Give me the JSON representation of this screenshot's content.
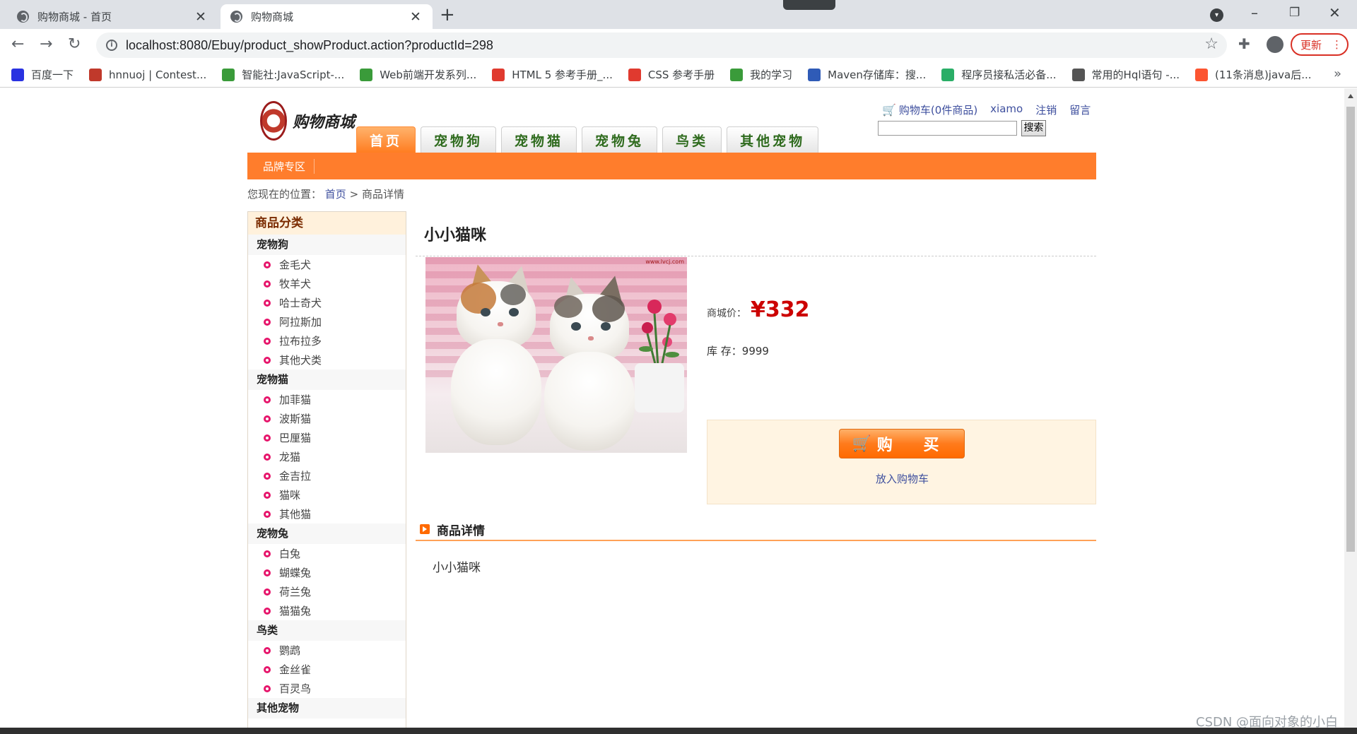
{
  "browser": {
    "tabs": [
      {
        "title": "购物商城 - 首页",
        "active": false
      },
      {
        "title": "购物商城",
        "active": true
      }
    ],
    "new_tab_symbol": "+",
    "url": "localhost:8080/Ebuy/product_showProduct.action?productId=298",
    "update_label": "更新",
    "bookmarks": [
      {
        "label": "百度一下",
        "icon": "baidu-icon",
        "color": "#2932e1"
      },
      {
        "label": "hnnuoj | Contest...",
        "icon": "pin-icon",
        "color": "#c0392b"
      },
      {
        "label": "智能社:JavaScript-...",
        "icon": "folder-icon",
        "color": "#3a9b3a"
      },
      {
        "label": "Web前端开发系列...",
        "icon": "folder-icon",
        "color": "#3a9b3a"
      },
      {
        "label": "HTML 5 参考手册_...",
        "icon": "owl-icon",
        "color": "#e03a2f"
      },
      {
        "label": "CSS 参考手册",
        "icon": "css-icon",
        "color": "#e03a2f"
      },
      {
        "label": "我的学习",
        "icon": "folder-icon",
        "color": "#3a9b3a"
      },
      {
        "label": "Maven存储库：搜...",
        "icon": "mvn-icon",
        "color": "#2f5bb7"
      },
      {
        "label": "程序员接私活必备...",
        "icon": "wechat-icon",
        "color": "#2aae67"
      },
      {
        "label": "常用的Hql语句 -...",
        "icon": "pen-icon",
        "color": "#555555"
      },
      {
        "label": "(11条消息)java后...",
        "icon": "csdn-icon",
        "color": "#fc5531"
      }
    ],
    "bookmarks_more": "»"
  },
  "site": {
    "logo_text": "购物商城",
    "nav_tabs": [
      {
        "label": "首页",
        "active": true
      },
      {
        "label": "宠物狗",
        "active": false
      },
      {
        "label": "宠物猫",
        "active": false
      },
      {
        "label": "宠物兔",
        "active": false
      },
      {
        "label": "鸟类",
        "active": false
      },
      {
        "label": "其他宠物",
        "active": false
      }
    ],
    "top_links": {
      "cart": "购物车(0件商品)",
      "user": "xiamo",
      "logout": "注销",
      "message": "留言"
    },
    "search_button": "搜索",
    "brand_zone": "品牌专区",
    "breadcrumb": {
      "prefix": "您现在的位置：",
      "home": "首页",
      "separator": ">",
      "current": "商品详情"
    }
  },
  "sidebar": {
    "title": "商品分类",
    "categories": [
      {
        "name": "宠物狗",
        "items": [
          "金毛犬",
          "牧羊犬",
          "哈士奇犬",
          "阿拉斯加",
          "拉布拉多",
          "其他犬类"
        ]
      },
      {
        "name": "宠物猫",
        "items": [
          "加菲猫",
          "波斯猫",
          "巴厘猫",
          "龙猫",
          "金吉拉",
          "猫咪",
          "其他猫"
        ]
      },
      {
        "name": "宠物兔",
        "items": [
          "白兔",
          "蝴蝶兔",
          "荷兰兔",
          "猫猫兔"
        ]
      },
      {
        "name": "鸟类",
        "items": [
          "鹦鹉",
          "金丝雀",
          "百灵鸟"
        ]
      },
      {
        "name": "其他宠物",
        "items": []
      }
    ]
  },
  "product": {
    "name": "小小猫咪",
    "image_watermark": "www.lvcj.com",
    "price_label": "商城价：",
    "price": "¥332",
    "stock_label": "库 存：",
    "stock": "9999",
    "buy_label": "购 买",
    "add_to_cart": "放入购物车",
    "detail_heading": "商品详情",
    "detail_text": "小小猫咪"
  },
  "watermark": "CSDN @面向对象的小白",
  "colors": {
    "accent_orange": "#ff7d2c",
    "price_red": "#cc0000",
    "link_blue": "#3e4f9e",
    "nav_green": "#2f6b1e"
  }
}
